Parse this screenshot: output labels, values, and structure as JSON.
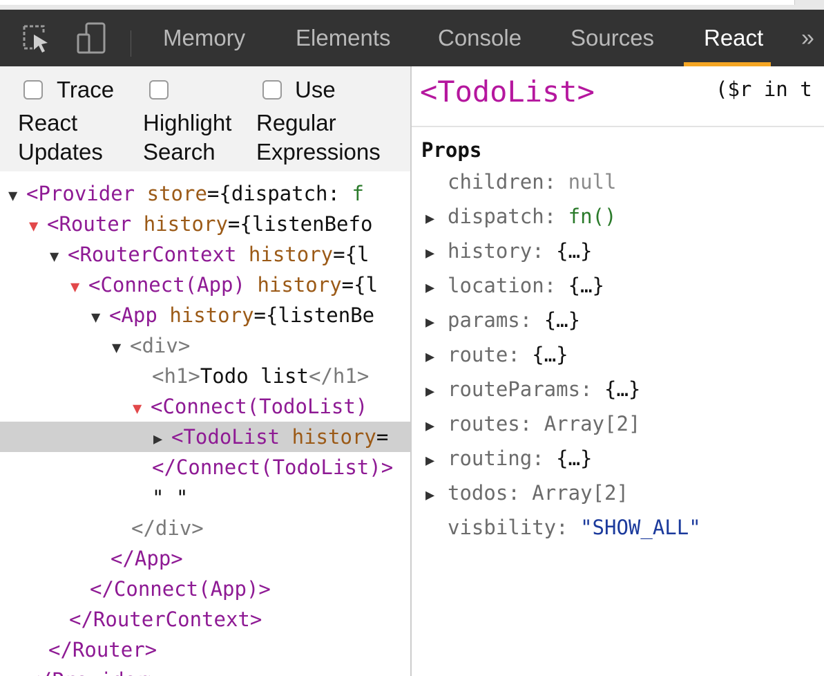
{
  "toolbar": {
    "tabs": [
      {
        "label": "Memory"
      },
      {
        "label": "Elements"
      },
      {
        "label": "Console"
      },
      {
        "label": "Sources"
      },
      {
        "label": "React",
        "active": true
      }
    ],
    "overflow": "»",
    "accent_color": "#f5a623"
  },
  "options": {
    "trace": {
      "line1": "Trace",
      "line2": "React",
      "line3": "Updates"
    },
    "highlight": {
      "line1": "Highlight",
      "line2": "Search"
    },
    "regex": {
      "line1": "Use",
      "line2": "Regular",
      "line3": "Expressions"
    }
  },
  "tree": {
    "r0": {
      "open": "<Provider",
      "attr": "store",
      "eq": "={dispatch: ",
      "fn": "f"
    },
    "r1": {
      "open": "<Router",
      "attr": "history",
      "eq": "={listenBefo"
    },
    "r2": {
      "open": "<RouterContext",
      "attr": "history",
      "eq": "={l"
    },
    "r3": {
      "open": "<Connect(App)",
      "attr": "history",
      "eq": "={l"
    },
    "r4": {
      "open": "<App",
      "attr": "history",
      "eq": "={listenBe"
    },
    "r5": {
      "open": "<div>"
    },
    "r6": {
      "open": "<h1>",
      "text": "Todo list",
      "close": "</h1>"
    },
    "r7": {
      "open": "<Connect(TodoList)"
    },
    "r8": {
      "open": "<TodoList",
      "attr": "history",
      "eq": "="
    },
    "r9": {
      "close": "</Connect(TodoList)>"
    },
    "r10": {
      "text": "\" \""
    },
    "r11": {
      "close": "</div>"
    },
    "r12": {
      "close": "</App>"
    },
    "r13": {
      "close": "</Connect(App)>"
    },
    "r14": {
      "close": "</RouterContext>"
    },
    "r15": {
      "close": "</Router>"
    },
    "r16": {
      "close": "</Provider>"
    }
  },
  "panel": {
    "title": "<TodoList>",
    "note": "($r in t",
    "props_title": "Props",
    "props": [
      {
        "key": "children",
        "value": "null"
      },
      {
        "key": "dispatch",
        "value": "fn()"
      },
      {
        "key": "history",
        "value": "{…}"
      },
      {
        "key": "location",
        "value": "{…}"
      },
      {
        "key": "params",
        "value": "{…}"
      },
      {
        "key": "route",
        "value": "{…}"
      },
      {
        "key": "routeParams",
        "value": "{…}"
      },
      {
        "key": "routes",
        "value": "Array[2]"
      },
      {
        "key": "routing",
        "value": "{…}"
      },
      {
        "key": "todos",
        "value": "Array[2]"
      },
      {
        "key": "visbility",
        "value": "\"SHOW_ALL\""
      }
    ]
  }
}
